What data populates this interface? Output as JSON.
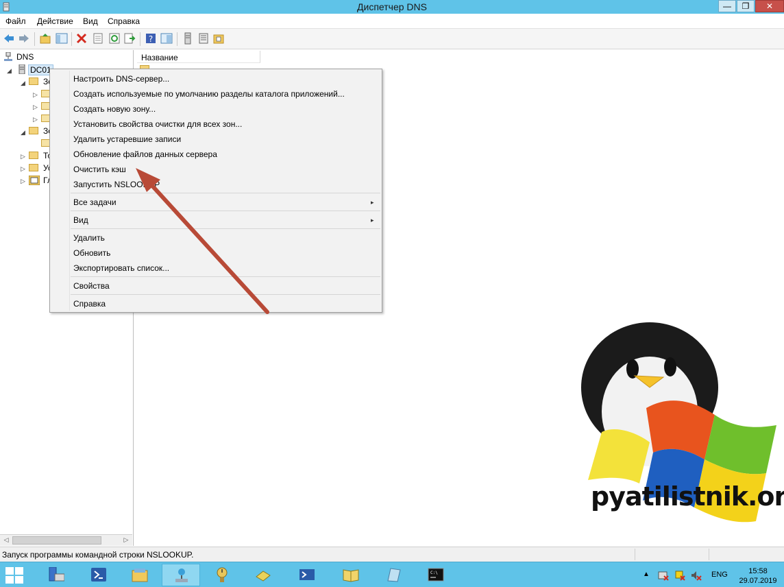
{
  "window": {
    "title": "Диспетчер DNS",
    "min_label": "—",
    "max_label": "❐",
    "close_label": "✕"
  },
  "menubar": {
    "items": [
      "Файл",
      "Действие",
      "Вид",
      "Справка"
    ]
  },
  "toolbar": {
    "icons": [
      "back-icon",
      "forward-icon",
      "up-folder-icon",
      "show-tree-icon",
      "delete-icon",
      "properties-icon",
      "refresh-icon",
      "export-icon",
      "help-icon",
      "console-icon",
      "server-icon",
      "list-icon",
      "zone-icon"
    ]
  },
  "tree": {
    "root": "DNS",
    "server": "DC01",
    "items": [
      "Зо",
      "Зо",
      "То",
      "Ус",
      "Гл"
    ]
  },
  "content": {
    "column_header": "Название"
  },
  "context_menu": {
    "items": [
      "Настроить DNS-сервер...",
      "Создать используемые по умолчанию разделы каталога приложений...",
      "Создать новую зону...",
      "Установить свойства очистки для всех зон...",
      "Удалить устаревшие записи",
      "Обновление файлов данных сервера",
      "Очистить кэш",
      "Запустить NSLOOKUP",
      "Все задачи",
      "Вид",
      "Удалить",
      "Обновить",
      "Экспортировать список...",
      "Свойства",
      "Справка"
    ],
    "submenu_arrow": "▸"
  },
  "statusbar": {
    "text": "Запуск программы командной строки NSLOOKUP."
  },
  "taskbar": {
    "language": "ENG",
    "time": "15:58",
    "date": "29.07.2019"
  },
  "logo": {
    "brand": "pyatilistnik.org"
  },
  "colors": {
    "titlebar": "#5fc3e8",
    "annotation_arrow": "#b84a37"
  }
}
